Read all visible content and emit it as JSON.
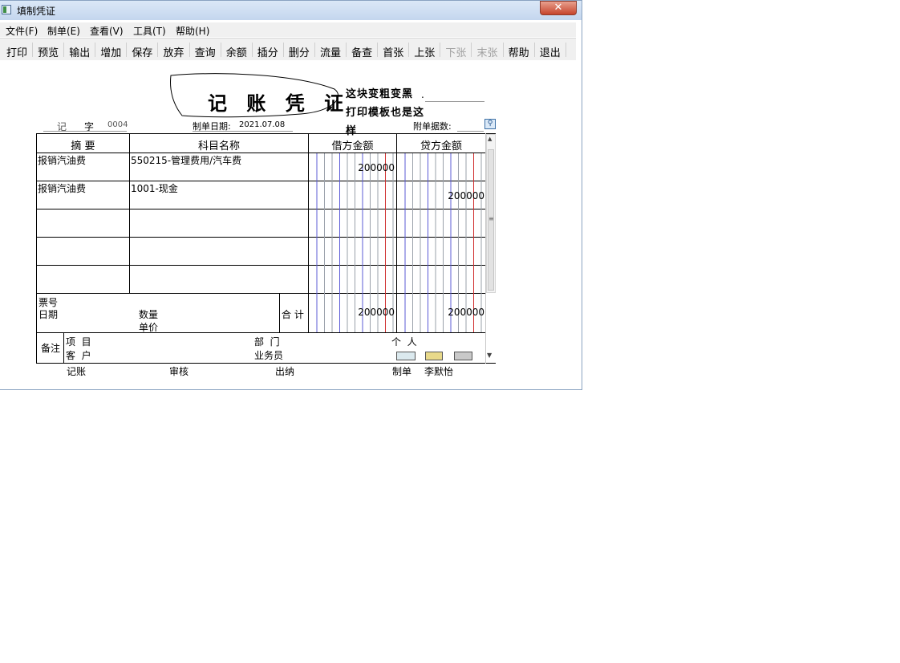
{
  "window": {
    "title": "填制凭证"
  },
  "menu": [
    "文件(F)",
    "制单(E)",
    "查看(V)",
    "工具(T)",
    "帮助(H)"
  ],
  "toolbar": [
    {
      "label": "打印",
      "enabled": true
    },
    {
      "label": "预览",
      "enabled": true
    },
    {
      "label": "输出",
      "enabled": true
    },
    {
      "label": "增加",
      "enabled": true
    },
    {
      "label": "保存",
      "enabled": true
    },
    {
      "label": "放弃",
      "enabled": true
    },
    {
      "label": "查询",
      "enabled": true
    },
    {
      "label": "余额",
      "enabled": true
    },
    {
      "label": "插分",
      "enabled": true
    },
    {
      "label": "删分",
      "enabled": true
    },
    {
      "label": "流量",
      "enabled": true
    },
    {
      "label": "备查",
      "enabled": true
    },
    {
      "label": "首张",
      "enabled": true
    },
    {
      "label": "上张",
      "enabled": true
    },
    {
      "label": "下张",
      "enabled": false
    },
    {
      "label": "末张",
      "enabled": false
    },
    {
      "label": "帮助",
      "enabled": true
    },
    {
      "label": "退出",
      "enabled": true
    }
  ],
  "voucher": {
    "title": "记 账 凭 证",
    "annotation_line1": "这块变粗变黑",
    "annotation_line2": "打印模板也是这",
    "annotation_line3": "样",
    "type_label": "记",
    "zi_label": "字",
    "number": "0004",
    "date_label": "制单日期:",
    "date": "2021.07.08",
    "attach_label": "附单据数:",
    "columns": {
      "summary": "摘 要",
      "account": "科目名称",
      "debit": "借方金额",
      "credit": "贷方金额"
    },
    "rows": [
      {
        "summary": "报销汽油费",
        "account": "550215-管理费用/汽车费",
        "debit": "200000",
        "credit": ""
      },
      {
        "summary": "报销汽油费",
        "account": "1001-现金",
        "debit": "",
        "credit": "200000"
      },
      {
        "summary": "",
        "account": "",
        "debit": "",
        "credit": ""
      },
      {
        "summary": "",
        "account": "",
        "debit": "",
        "credit": ""
      },
      {
        "summary": "",
        "account": "",
        "debit": "",
        "credit": ""
      }
    ],
    "footer": {
      "ticket_label": "票号",
      "date_label": "日期",
      "qty_label": "数量",
      "price_label": "单价",
      "total_label": "合 计",
      "debit_total": "200000",
      "credit_total": "200000"
    },
    "remarks": {
      "label": "备注",
      "project_label": "项  目",
      "dept_label": "部  门",
      "person_label": "个  人",
      "customer_label": "客  户",
      "salesman_label": "业务员"
    },
    "signatures": {
      "bookkeeping": "记账",
      "audit": "审核",
      "cashier": "出纳",
      "maker_label": "制单",
      "maker_name": "李默怡"
    }
  }
}
